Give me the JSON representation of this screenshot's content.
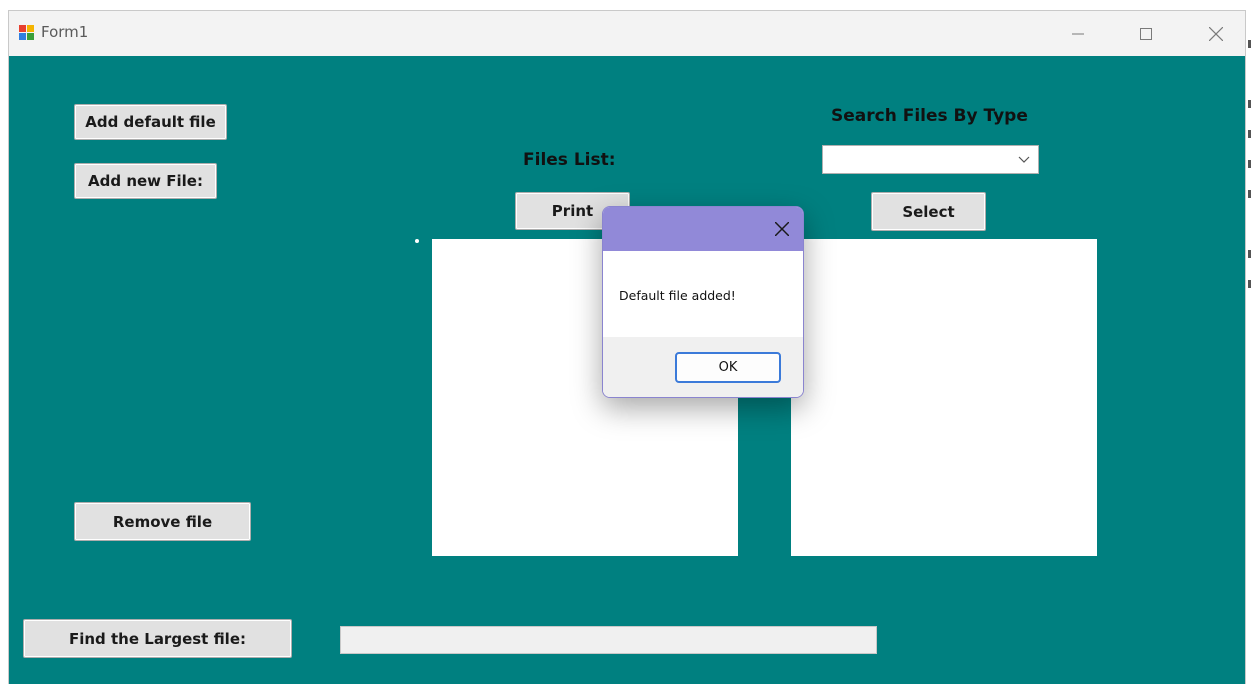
{
  "window": {
    "title": "Form1"
  },
  "form": {
    "add_default_label": "Add default file",
    "add_new_label": "Add new File:",
    "remove_label": "Remove file",
    "find_largest_label": "Find the Largest file:",
    "files_list_label": "Files List:",
    "print_label": "Print",
    "search_label": "Search Files By Type",
    "select_label": "Select",
    "type_combo_value": "",
    "largest_file_value": ""
  },
  "dialog": {
    "message": "Default file added!",
    "ok_label": "OK"
  },
  "colors": {
    "form_background": "#008080",
    "dialog_title": "#9189d8",
    "ok_border": "#3b7ad9"
  }
}
